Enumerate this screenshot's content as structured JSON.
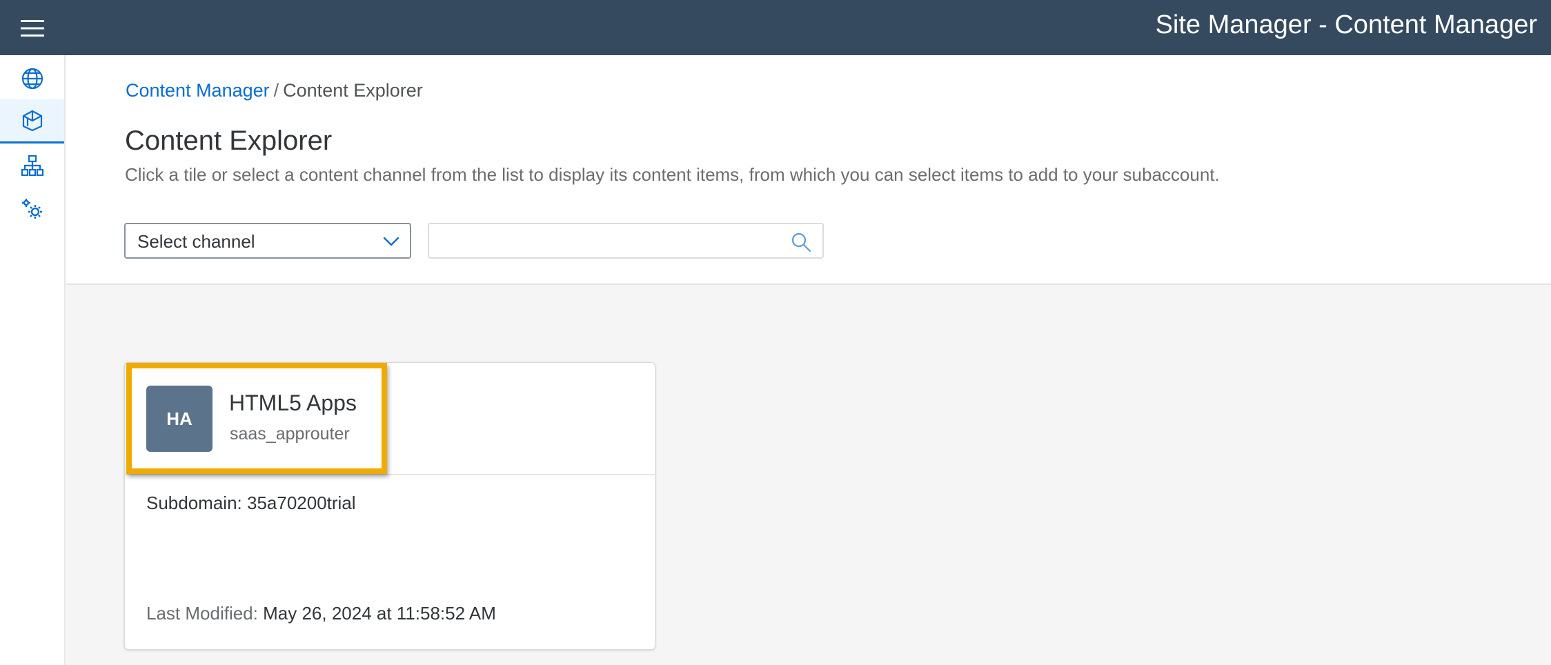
{
  "shell": {
    "title": "Site Manager - Content Manager",
    "menu_icon": "hamburger-menu-icon",
    "header_color": "#354a5f"
  },
  "side_nav": {
    "items": [
      {
        "icon": "globe-icon",
        "selected": false
      },
      {
        "icon": "content-cube-icon",
        "selected": true
      },
      {
        "icon": "site-hierarchy-icon",
        "selected": false
      },
      {
        "icon": "settings-gears-icon",
        "selected": false
      }
    ],
    "selected_color": "#0a6ed1"
  },
  "breadcrumb": {
    "parent": "Content Manager",
    "separator": "/",
    "current": "Content Explorer"
  },
  "page": {
    "title": "Content Explorer",
    "description": "Click a tile or select a content channel from the list to display its content items, from which you can select items to add to your subaccount."
  },
  "filters": {
    "channel_select_label": "Select channel",
    "search_value": "",
    "search_placeholder": ""
  },
  "tiles": [
    {
      "avatar_initials": "HA",
      "title": "HTML5 Apps",
      "subtitle": "saas_approuter",
      "subdomain_text": "Subdomain: 35a70200trial",
      "last_modified_label": "Last Modified:",
      "last_modified_value": "May 26, 2024 at 11:58:52 AM",
      "highlighted": true
    }
  ],
  "colors": {
    "accent": "#0a6ed1",
    "highlight": "#f0ab00",
    "avatar_bg": "#5b738b"
  }
}
